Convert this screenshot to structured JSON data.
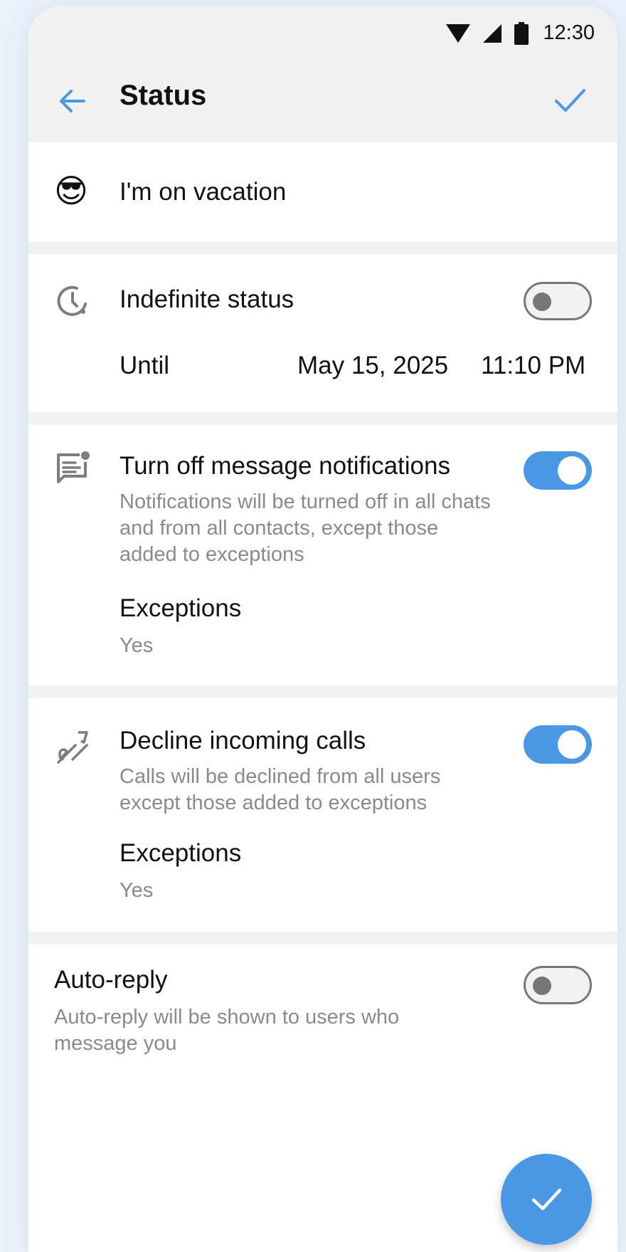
{
  "status_bar": {
    "time": "12:30"
  },
  "app_bar": {
    "title": "Status"
  },
  "status_message": {
    "emoji": "😎",
    "text": "I'm on vacation"
  },
  "duration": {
    "indefinite_label": "Indefinite status",
    "indefinite_enabled": false,
    "until_label": "Until",
    "date": "May 15, 2025",
    "time": "11:10 PM"
  },
  "notifications": {
    "title": "Turn off message notifications",
    "description": "Notifications will be turned off in all chats and from all contacts, except those added to exceptions",
    "enabled": true,
    "exceptions_label": "Exceptions",
    "exceptions_value": "Yes"
  },
  "calls": {
    "title": "Decline incoming calls",
    "description": "Calls will be declined from all users except those added to exceptions",
    "enabled": true,
    "exceptions_label": "Exceptions",
    "exceptions_value": "Yes"
  },
  "auto_reply": {
    "title": "Auto-reply",
    "description": "Auto-reply will be shown to users who message you",
    "enabled": false
  },
  "colors": {
    "accent": "#4a97e4",
    "toolbar_bg": "#f1f1f1",
    "secondary_text": "#8a8a8a"
  }
}
